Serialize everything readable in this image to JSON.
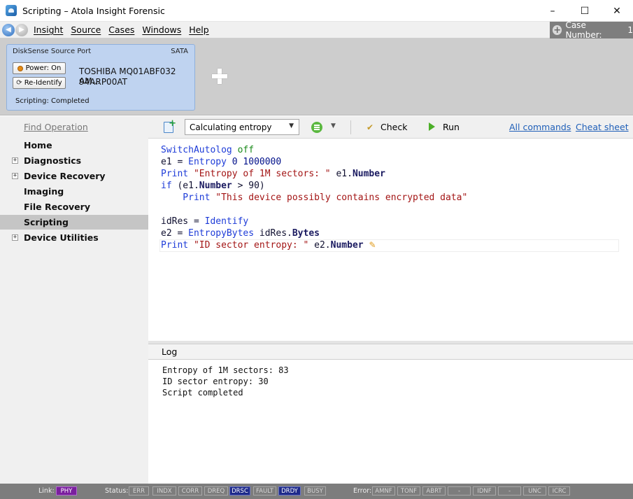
{
  "window": {
    "title": "Scripting – Atola Insight Forensic",
    "controls": {
      "minimize": "–",
      "maximize": "☐",
      "close": "✕"
    }
  },
  "menu": {
    "items": [
      "Insight",
      "Source",
      "Cases",
      "Windows",
      "Help"
    ],
    "case_label": "Case Number:",
    "case_number": "1"
  },
  "port": {
    "title": "DiskSense Source Port",
    "type": "SATA",
    "power_label": "Power: On",
    "reidentify_label": "Re-Identify",
    "drive_model": "TOSHIBA MQ01ABF032 AM...",
    "drive_serial": "94ARP00AT",
    "status": "Scripting: Completed"
  },
  "sidebar": {
    "find_operation": "Find Operation",
    "items": [
      {
        "label": "Home",
        "expandable": false,
        "active": false
      },
      {
        "label": "Diagnostics",
        "expandable": true,
        "active": false
      },
      {
        "label": "Device Recovery",
        "expandable": true,
        "active": false
      },
      {
        "label": "Imaging",
        "expandable": false,
        "active": false
      },
      {
        "label": "File Recovery",
        "expandable": false,
        "active": false
      },
      {
        "label": "Scripting",
        "expandable": false,
        "active": true
      },
      {
        "label": "Device Utilities",
        "expandable": true,
        "active": false
      }
    ]
  },
  "toolbar": {
    "script_selected": "Calculating entropy",
    "check_label": "Check",
    "run_label": "Run",
    "all_commands_label": "All commands",
    "cheat_sheet_label": "Cheat sheet"
  },
  "code": {
    "l1a": "SwitchAutolog",
    "l1b": " off",
    "l2a": "e1 = ",
    "l2b": "Entropy",
    "l2c": " 0 1000000",
    "l3a": "Print",
    "l3b": " \"Entropy of 1M sectors: \"",
    "l3c": " e1.",
    "l3d": "Number",
    "l4a": "if",
    "l4b": " (e1.",
    "l4c": "Number",
    "l4d": " > 90)",
    "l5a": "    Print",
    "l5b": " \"This device possibly contains encrypted data\"",
    "l7a": "idRes = ",
    "l7b": "Identify",
    "l8a": "e2 = ",
    "l8b": "EntropyBytes",
    "l8c": " idRes.",
    "l8d": "Bytes",
    "l9a": "Print",
    "l9b": " \"ID sector entropy: \"",
    "l9c": " e2.",
    "l9d": "Number"
  },
  "log": {
    "header": "Log",
    "lines": [
      "Entropy of 1M sectors: 83",
      "ID sector entropy: 30",
      "Script completed"
    ]
  },
  "status": {
    "link_label": "Link:",
    "link_value": "PHY",
    "status_label": "Status:",
    "status_flags": [
      "ERR",
      "INDX",
      "CORR",
      "DREQ",
      "DRSC",
      "FAULT",
      "DRDY",
      "BUSY"
    ],
    "error_label": "Error:",
    "error_flags": [
      "AMNF",
      "TONF",
      "ABRT",
      "-",
      "IDNF",
      "-",
      "UNC",
      "ICRC"
    ]
  }
}
